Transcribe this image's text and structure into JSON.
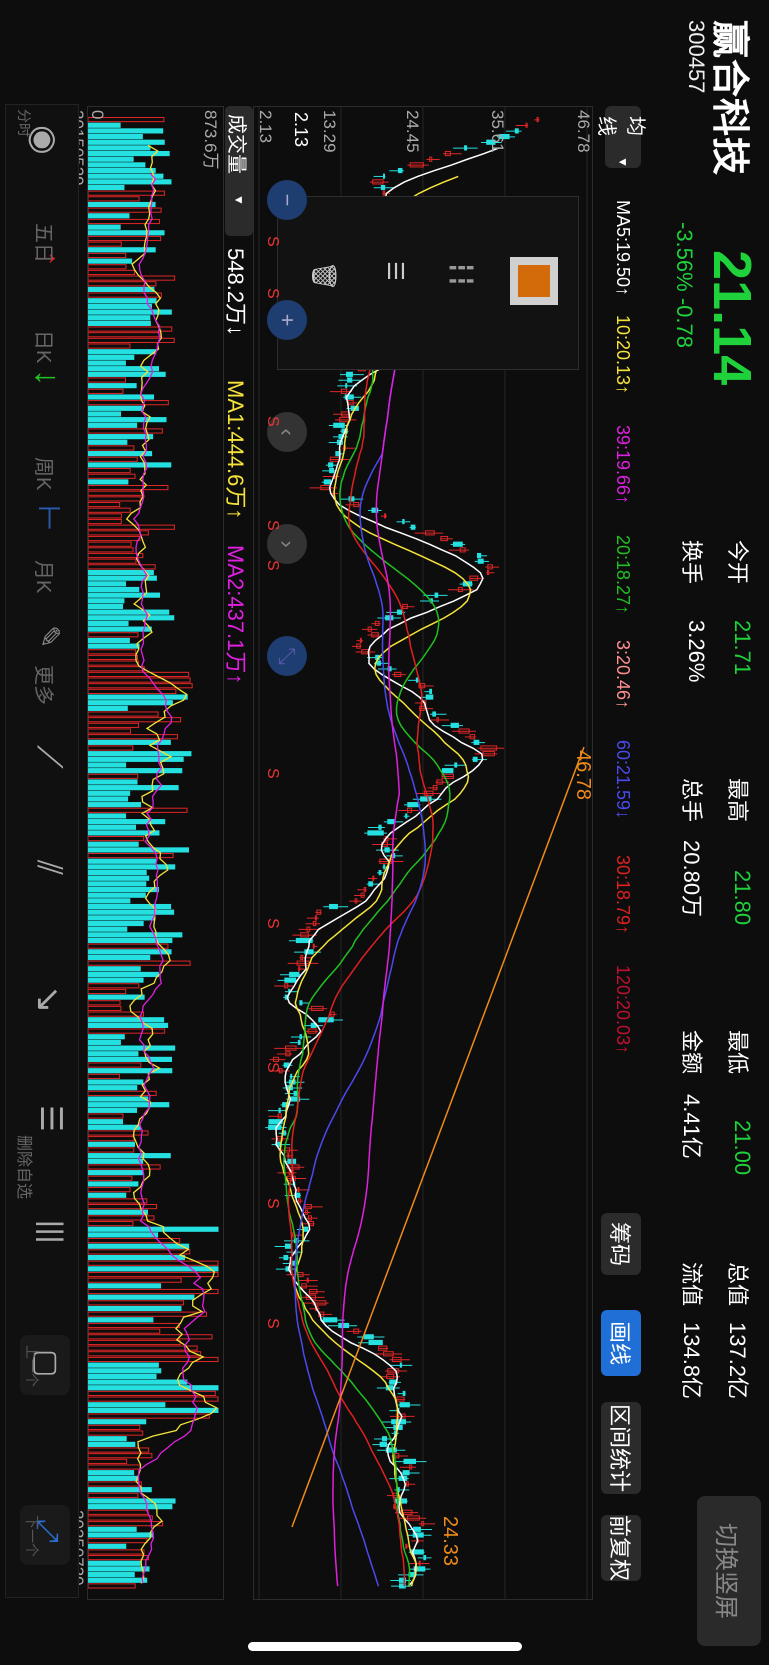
{
  "header": {
    "name": "赢合科技",
    "code": "300457",
    "price": "21.14",
    "change": "-3.56% -0.78",
    "switch_button": "切换竖屏"
  },
  "stats": [
    {
      "label": "今开",
      "value": "21.71"
    },
    {
      "label": "最高",
      "value": "21.80"
    },
    {
      "label": "最低",
      "value": "21.00"
    },
    {
      "label": "总值",
      "value": "137.2亿"
    },
    {
      "label": "换手",
      "value": "3.26%"
    },
    {
      "label": "总手",
      "value": "20.80万"
    },
    {
      "label": "金额",
      "value": "4.41亿"
    },
    {
      "label": "流值",
      "value": "134.8亿"
    }
  ],
  "toolbar": {
    "ma_label": "均线",
    "ma_values": [
      "MA5:19.50↑",
      "10:20.13↑",
      "39:19.66↑",
      "20:18.27↑",
      "3:20.46↑",
      "60:21.59↓",
      "30:18.79↑",
      "120:20.03↑"
    ],
    "chips": "筹码",
    "draw": "画线",
    "range_stats": "区间统计",
    "adjust": "前复权"
  },
  "colors": {
    "ma": [
      "#ffffff",
      "#f5e33a",
      "#e020e0",
      "#20c020",
      "#ff9090",
      "#4a4af0",
      "#e02020",
      "#c01030"
    ],
    "up": "#e02626",
    "down": "#25e0e0",
    "orange": "#f08a1a",
    "active": "#1f6fd6"
  },
  "price_axis": {
    "labels": [
      "46.78",
      "35.61",
      "24.45",
      "13.29",
      "2.13"
    ],
    "high_label": "46.78",
    "high_marker": "46.78",
    "low_marker": "24.33",
    "arrow_label": "2.13"
  },
  "volume": {
    "button": "成交量",
    "value": "548.2万↓",
    "ma1": "MA1:444.6万↑",
    "ma2": "MA2:437.1万↑",
    "max_label": "873.6万",
    "zero_label": "0"
  },
  "dates": {
    "start": "20150529",
    "end": "20250730"
  },
  "bottom_bar": [
    "分时",
    "五日",
    "日K",
    "周K",
    "月K",
    "更多",
    "删除自选",
    "上一个",
    "下一个"
  ],
  "signals": [
    "S",
    "S",
    "S",
    "S",
    "S",
    "S",
    "S",
    "S",
    "S",
    "S"
  ],
  "chart_data": {
    "type": "candlestick",
    "x_range": [
      "20150529",
      "20250730"
    ],
    "ylim": [
      2.13,
      46.78
    ],
    "y_ticks": [
      46.78,
      35.61,
      24.45,
      13.29,
      2.13
    ],
    "volume_ylim": [
      0,
      873.6
    ],
    "volume_unit": "万",
    "close_trend": [
      40,
      35,
      25,
      18,
      21,
      17,
      15,
      13,
      20,
      18,
      15,
      22,
      16,
      14,
      15,
      13,
      14,
      12,
      11,
      16,
      23,
      30,
      34,
      30,
      22,
      18,
      16,
      20,
      26,
      24,
      30,
      34,
      28,
      26,
      22,
      18,
      20,
      19,
      17,
      10,
      8,
      9,
      7,
      6,
      12,
      8,
      5,
      6,
      7,
      4,
      5,
      7,
      6,
      8,
      9,
      7,
      6,
      8,
      10,
      12,
      18,
      21,
      20,
      22,
      21,
      19,
      23,
      22,
      21,
      24,
      23,
      25,
      21
    ],
    "ma_lines": [
      "MA5",
      "MA10",
      "MA20",
      "MA30",
      "MA60",
      "MA120"
    ]
  }
}
